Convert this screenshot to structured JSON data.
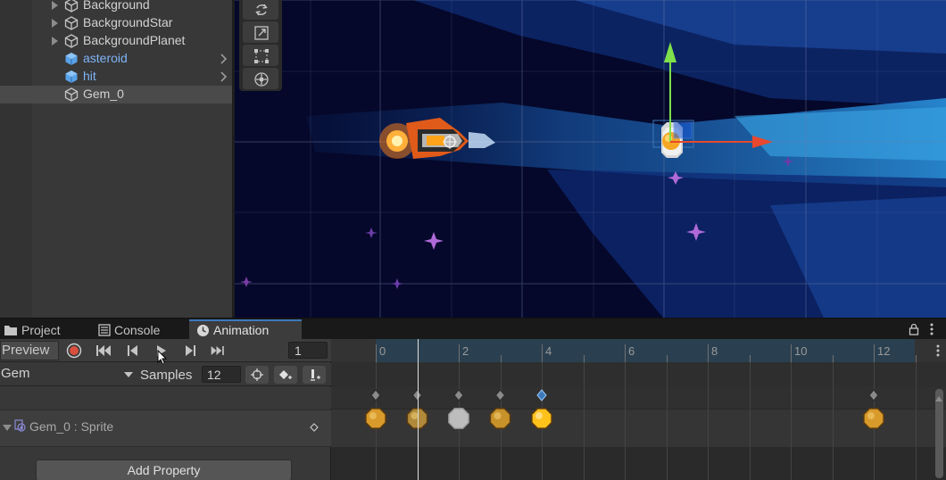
{
  "hierarchy": {
    "items": [
      {
        "label": "Background",
        "type": "gameobject"
      },
      {
        "label": "BackgroundStar",
        "type": "gameobject"
      },
      {
        "label": "BackgroundPlanet",
        "type": "gameobject"
      },
      {
        "label": "asteroid",
        "type": "prefab"
      },
      {
        "label": "hit",
        "type": "prefab"
      },
      {
        "label": "Gem_0",
        "type": "gameobject",
        "selected": true
      }
    ]
  },
  "scene_tools": [
    "rotate-tool",
    "scale-tool",
    "rect-tool",
    "transform-tool"
  ],
  "tabs": [
    {
      "label": "Project",
      "icon": "folder-icon"
    },
    {
      "label": "Console",
      "icon": "console-icon"
    },
    {
      "label": "Animation",
      "icon": "clock-icon",
      "active": true
    }
  ],
  "animation": {
    "preview_label": "Preview",
    "current_frame": "1",
    "clip_name": "Gem",
    "samples_label": "Samples",
    "samples_value": "12",
    "property_label": "Gem_0 : Sprite",
    "add_property_label": "Add Property",
    "ruler_labels": [
      "0",
      "2",
      "4",
      "6",
      "8",
      "10",
      "12"
    ],
    "keyframes": [
      0,
      1,
      2,
      3,
      4,
      12
    ],
    "selected_keyframe": 4,
    "playhead_frame": 1
  },
  "colors": {
    "accent": "#3a79bb",
    "record": "#d9503f",
    "prefab_text": "#7fb3f5"
  }
}
